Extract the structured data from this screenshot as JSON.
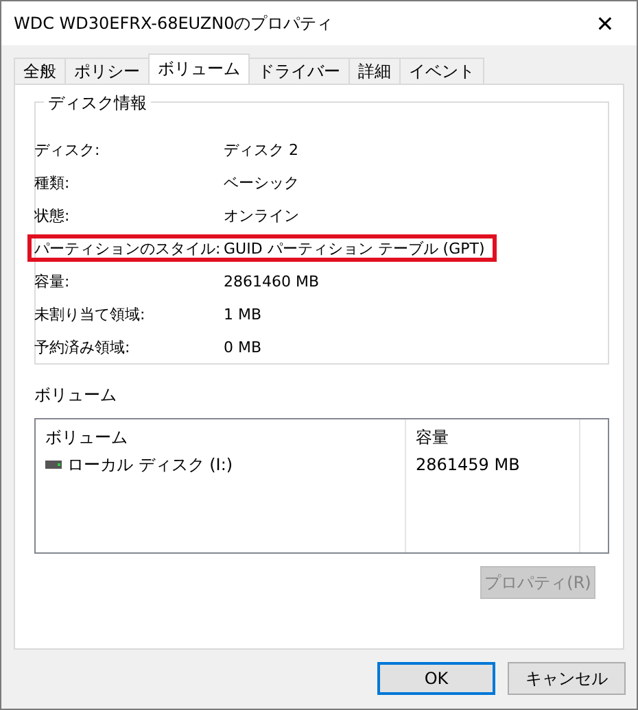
{
  "window": {
    "title": "WDC WD30EFRX-68EUZN0のプロパティ",
    "close": "✕"
  },
  "tabs": [
    {
      "label": "全般",
      "selected": false
    },
    {
      "label": "ポリシー",
      "selected": false
    },
    {
      "label": "ボリューム",
      "selected": true
    },
    {
      "label": "ドライバー",
      "selected": false
    },
    {
      "label": "詳細",
      "selected": false
    },
    {
      "label": "イベント",
      "selected": false
    }
  ],
  "disk_info": {
    "title": "ディスク情報",
    "rows": [
      {
        "label": "ディスク:",
        "value": "ディスク 2",
        "highlighted": false
      },
      {
        "label": "種類:",
        "value": "ベーシック",
        "highlighted": false
      },
      {
        "label": "状態:",
        "value": "オンライン",
        "highlighted": false
      },
      {
        "label": "パーティションのスタイル:",
        "value": "GUID パーティション テーブル (GPT)",
        "highlighted": true
      },
      {
        "label": "容量:",
        "value": "2861460 MB",
        "highlighted": false
      },
      {
        "label": "未割り当て領域:",
        "value": "1 MB",
        "highlighted": false
      },
      {
        "label": "予約済み領域:",
        "value": "0 MB",
        "highlighted": false
      }
    ]
  },
  "volumes": {
    "title": "ボリューム",
    "columns": [
      "ボリューム",
      "容量"
    ],
    "rows": [
      {
        "name": "ローカル ディスク (I:)",
        "capacity": "2861459 MB",
        "selected": false
      }
    ],
    "properties_button": {
      "label": "プロパティ(R)",
      "disabled": true
    }
  },
  "buttons": [
    {
      "label": "OK",
      "focused": true
    },
    {
      "label": "キャンセル",
      "focused": false
    }
  ]
}
